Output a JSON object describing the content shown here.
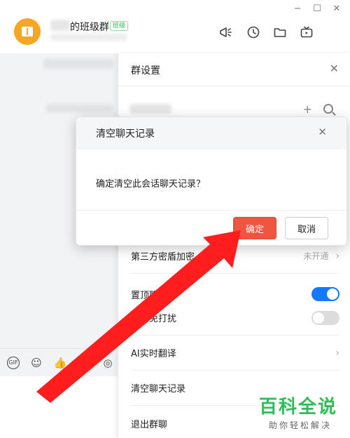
{
  "window": {
    "minimize_glyph": "−",
    "maximize_glyph": "☐",
    "close_glyph": "✕"
  },
  "header": {
    "group_name": "的班级群",
    "badge": "班级"
  },
  "settings_panel": {
    "title": "群设置",
    "close_glyph": "✕",
    "add_glyph": "+",
    "rows": [
      {
        "label": "第三方密盾加密",
        "value": "未开通",
        "chevron": "›"
      },
      {
        "label": "置顶聊天",
        "toggle": "on"
      },
      {
        "label": "消息免打扰",
        "toggle": "off"
      },
      {
        "label": "AI实时翻译",
        "chevron": "›"
      },
      {
        "label": "清空聊天记录"
      },
      {
        "label": "退出群聊"
      }
    ]
  },
  "dialog": {
    "title": "清空聊天记录",
    "close_glyph": "✕",
    "message": "确定清空此会话聊天记录？",
    "confirm_label": "确定",
    "cancel_label": "取消"
  },
  "toolbar": {
    "gif_glyph": "GIF",
    "emoji_glyph": "☺",
    "like_glyph": "👍",
    "scissors_glyph": "✂",
    "at_glyph": "◎"
  },
  "watermark": {
    "main": "百科全说",
    "sub": "助你轻松解决"
  },
  "colors": {
    "confirm": "#f0553f",
    "toggle_on": "#1677ff",
    "toggle_off": "#dcdcdc",
    "avatar": "#f5a623",
    "arrow": "#ff1e1e",
    "watermark": "#2fbd5a"
  }
}
